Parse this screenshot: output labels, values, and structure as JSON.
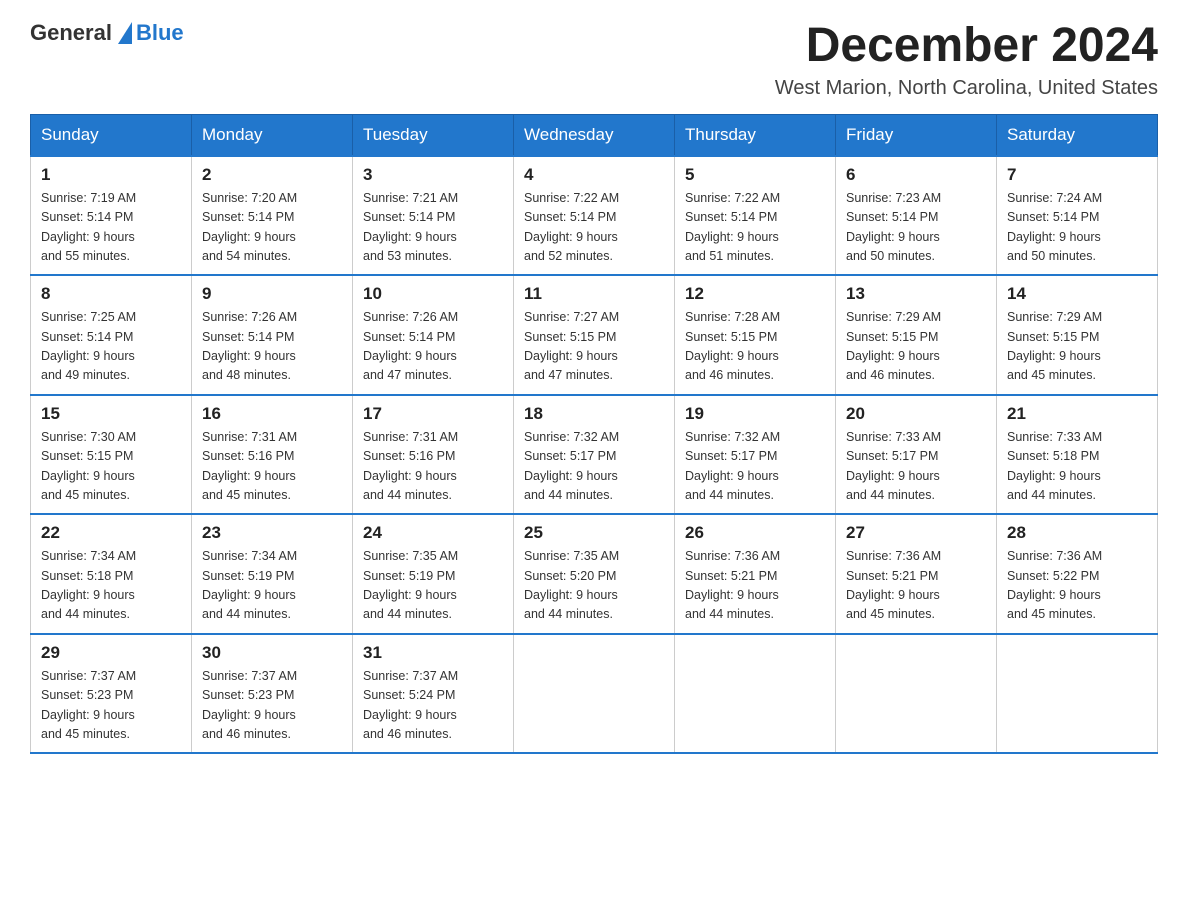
{
  "logo": {
    "text_general": "General",
    "triangle": "▶",
    "text_blue": "Blue"
  },
  "header": {
    "month_title": "December 2024",
    "location": "West Marion, North Carolina, United States"
  },
  "weekdays": [
    "Sunday",
    "Monday",
    "Tuesday",
    "Wednesday",
    "Thursday",
    "Friday",
    "Saturday"
  ],
  "weeks": [
    [
      {
        "day": "1",
        "sunrise": "7:19 AM",
        "sunset": "5:14 PM",
        "daylight": "9 hours and 55 minutes."
      },
      {
        "day": "2",
        "sunrise": "7:20 AM",
        "sunset": "5:14 PM",
        "daylight": "9 hours and 54 minutes."
      },
      {
        "day": "3",
        "sunrise": "7:21 AM",
        "sunset": "5:14 PM",
        "daylight": "9 hours and 53 minutes."
      },
      {
        "day": "4",
        "sunrise": "7:22 AM",
        "sunset": "5:14 PM",
        "daylight": "9 hours and 52 minutes."
      },
      {
        "day": "5",
        "sunrise": "7:22 AM",
        "sunset": "5:14 PM",
        "daylight": "9 hours and 51 minutes."
      },
      {
        "day": "6",
        "sunrise": "7:23 AM",
        "sunset": "5:14 PM",
        "daylight": "9 hours and 50 minutes."
      },
      {
        "day": "7",
        "sunrise": "7:24 AM",
        "sunset": "5:14 PM",
        "daylight": "9 hours and 50 minutes."
      }
    ],
    [
      {
        "day": "8",
        "sunrise": "7:25 AM",
        "sunset": "5:14 PM",
        "daylight": "9 hours and 49 minutes."
      },
      {
        "day": "9",
        "sunrise": "7:26 AM",
        "sunset": "5:14 PM",
        "daylight": "9 hours and 48 minutes."
      },
      {
        "day": "10",
        "sunrise": "7:26 AM",
        "sunset": "5:14 PM",
        "daylight": "9 hours and 47 minutes."
      },
      {
        "day": "11",
        "sunrise": "7:27 AM",
        "sunset": "5:15 PM",
        "daylight": "9 hours and 47 minutes."
      },
      {
        "day": "12",
        "sunrise": "7:28 AM",
        "sunset": "5:15 PM",
        "daylight": "9 hours and 46 minutes."
      },
      {
        "day": "13",
        "sunrise": "7:29 AM",
        "sunset": "5:15 PM",
        "daylight": "9 hours and 46 minutes."
      },
      {
        "day": "14",
        "sunrise": "7:29 AM",
        "sunset": "5:15 PM",
        "daylight": "9 hours and 45 minutes."
      }
    ],
    [
      {
        "day": "15",
        "sunrise": "7:30 AM",
        "sunset": "5:15 PM",
        "daylight": "9 hours and 45 minutes."
      },
      {
        "day": "16",
        "sunrise": "7:31 AM",
        "sunset": "5:16 PM",
        "daylight": "9 hours and 45 minutes."
      },
      {
        "day": "17",
        "sunrise": "7:31 AM",
        "sunset": "5:16 PM",
        "daylight": "9 hours and 44 minutes."
      },
      {
        "day": "18",
        "sunrise": "7:32 AM",
        "sunset": "5:17 PM",
        "daylight": "9 hours and 44 minutes."
      },
      {
        "day": "19",
        "sunrise": "7:32 AM",
        "sunset": "5:17 PM",
        "daylight": "9 hours and 44 minutes."
      },
      {
        "day": "20",
        "sunrise": "7:33 AM",
        "sunset": "5:17 PM",
        "daylight": "9 hours and 44 minutes."
      },
      {
        "day": "21",
        "sunrise": "7:33 AM",
        "sunset": "5:18 PM",
        "daylight": "9 hours and 44 minutes."
      }
    ],
    [
      {
        "day": "22",
        "sunrise": "7:34 AM",
        "sunset": "5:18 PM",
        "daylight": "9 hours and 44 minutes."
      },
      {
        "day": "23",
        "sunrise": "7:34 AM",
        "sunset": "5:19 PM",
        "daylight": "9 hours and 44 minutes."
      },
      {
        "day": "24",
        "sunrise": "7:35 AM",
        "sunset": "5:19 PM",
        "daylight": "9 hours and 44 minutes."
      },
      {
        "day": "25",
        "sunrise": "7:35 AM",
        "sunset": "5:20 PM",
        "daylight": "9 hours and 44 minutes."
      },
      {
        "day": "26",
        "sunrise": "7:36 AM",
        "sunset": "5:21 PM",
        "daylight": "9 hours and 44 minutes."
      },
      {
        "day": "27",
        "sunrise": "7:36 AM",
        "sunset": "5:21 PM",
        "daylight": "9 hours and 45 minutes."
      },
      {
        "day": "28",
        "sunrise": "7:36 AM",
        "sunset": "5:22 PM",
        "daylight": "9 hours and 45 minutes."
      }
    ],
    [
      {
        "day": "29",
        "sunrise": "7:37 AM",
        "sunset": "5:23 PM",
        "daylight": "9 hours and 45 minutes."
      },
      {
        "day": "30",
        "sunrise": "7:37 AM",
        "sunset": "5:23 PM",
        "daylight": "9 hours and 46 minutes."
      },
      {
        "day": "31",
        "sunrise": "7:37 AM",
        "sunset": "5:24 PM",
        "daylight": "9 hours and 46 minutes."
      },
      null,
      null,
      null,
      null
    ]
  ],
  "labels": {
    "sunrise": "Sunrise: ",
    "sunset": "Sunset: ",
    "daylight": "Daylight: "
  }
}
